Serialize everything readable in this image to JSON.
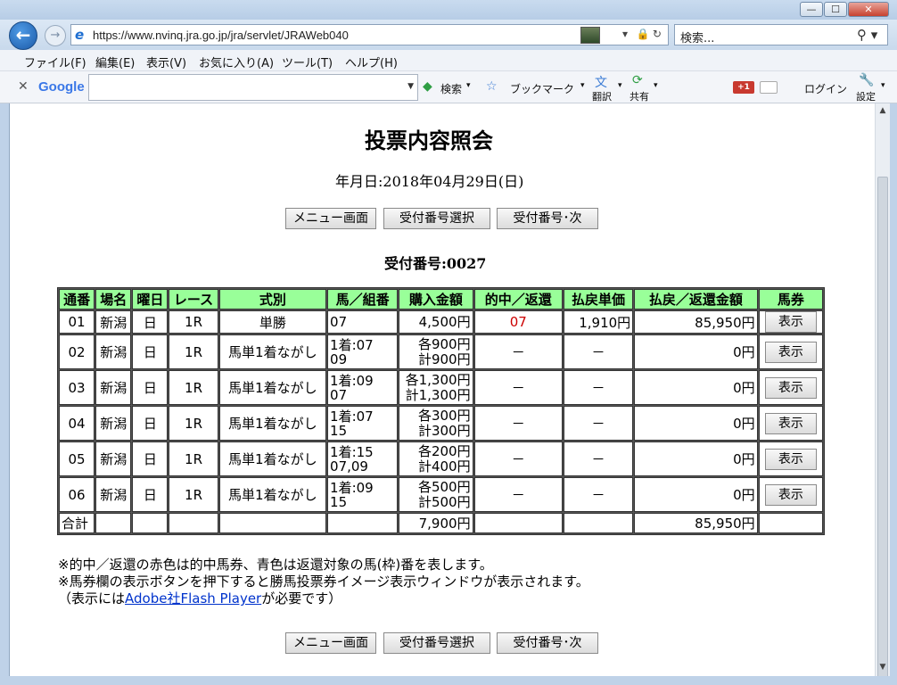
{
  "browser": {
    "window_buttons": {
      "minimize": "—",
      "maximize": "☐",
      "close": "✕"
    },
    "url": "https://www.nvinq.jra.go.jp/jra/servlet/JRAWeb040",
    "search_placeholder": "検索...",
    "menu": [
      "ファイル(F)",
      "編集(E)",
      "表示(V)",
      "お気に入り(A)",
      "ツール(T)",
      "ヘルプ(H)"
    ],
    "google_bar": {
      "logo": "Google",
      "search_label": "検索",
      "bookmark_label": "ブックマーク",
      "translate_label": "翻訳",
      "share_label": "共有",
      "plus_label": "+1",
      "login_label": "ログイン",
      "settings_label": "設定"
    }
  },
  "page": {
    "title": "投票内容照会",
    "date_line": "年月日:2018年04月29日(日)",
    "buttons": {
      "menu": "メニュー画面",
      "select": "受付番号選択",
      "next": "受付番号･次"
    },
    "receipt_line": "受付番号:0027",
    "table": {
      "headers": [
        "通番",
        "場名",
        "曜日",
        "レース",
        "式別",
        "馬／組番",
        "購入金額",
        "的中／返還",
        "払戻単価",
        "払戻／返還金額",
        "馬券"
      ],
      "rows": [
        {
          "no": "01",
          "venue": "新潟",
          "day": "日",
          "race": "1R",
          "type": "単勝",
          "combo1": "07",
          "combo2": "",
          "amount1": "4,500円",
          "amount2": "",
          "hit": "07",
          "unit": "1,910円",
          "payout": "85,950円",
          "ticket": "表示"
        },
        {
          "no": "02",
          "venue": "新潟",
          "day": "日",
          "race": "1R",
          "type": "馬単1着ながし",
          "combo1": "1着:07",
          "combo2": "09",
          "amount1": "各900円",
          "amount2": "計900円",
          "hit": "－",
          "unit": "－",
          "payout": "0円",
          "ticket": "表示"
        },
        {
          "no": "03",
          "venue": "新潟",
          "day": "日",
          "race": "1R",
          "type": "馬単1着ながし",
          "combo1": "1着:09",
          "combo2": "07",
          "amount1": "各1,300円",
          "amount2": "計1,300円",
          "hit": "－",
          "unit": "－",
          "payout": "0円",
          "ticket": "表示"
        },
        {
          "no": "04",
          "venue": "新潟",
          "day": "日",
          "race": "1R",
          "type": "馬単1着ながし",
          "combo1": "1着:07",
          "combo2": "15",
          "amount1": "各300円",
          "amount2": "計300円",
          "hit": "－",
          "unit": "－",
          "payout": "0円",
          "ticket": "表示"
        },
        {
          "no": "05",
          "venue": "新潟",
          "day": "日",
          "race": "1R",
          "type": "馬単1着ながし",
          "combo1": "1着:15",
          "combo2": "07,09",
          "amount1": "各200円",
          "amount2": "計400円",
          "hit": "－",
          "unit": "－",
          "payout": "0円",
          "ticket": "表示"
        },
        {
          "no": "06",
          "venue": "新潟",
          "day": "日",
          "race": "1R",
          "type": "馬単1着ながし",
          "combo1": "1着:09",
          "combo2": "15",
          "amount1": "各500円",
          "amount2": "計500円",
          "hit": "－",
          "unit": "－",
          "payout": "0円",
          "ticket": "表示"
        }
      ],
      "total": {
        "label": "合計",
        "amount": "7,900円",
        "payout": "85,950円"
      }
    },
    "notes": {
      "line1": "※的中／返還の赤色は的中馬券、青色は返還対象の馬(枠)番を表します。",
      "line2": "※馬券欄の表示ボタンを押下すると勝馬投票券イメージ表示ウィンドウが表示されます。",
      "line3_prefix": "（表示には",
      "line3_link": "Adobe社Flash Player",
      "line3_suffix": "が必要です）"
    }
  }
}
